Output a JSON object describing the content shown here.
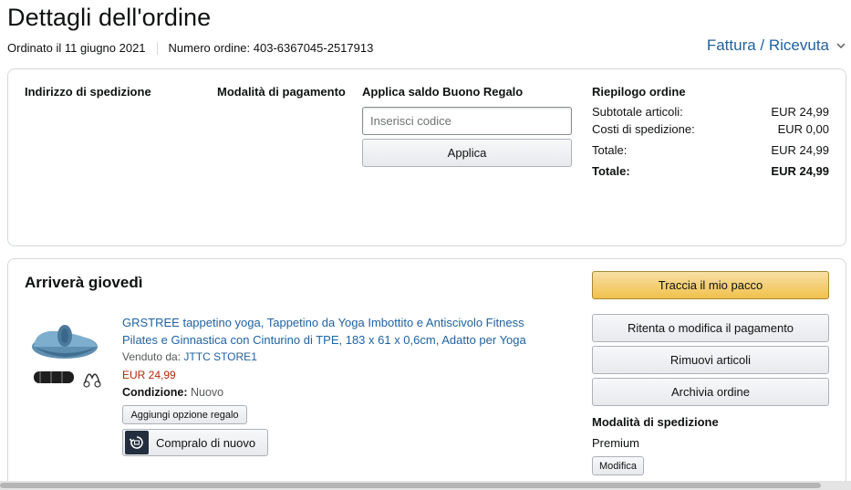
{
  "header": {
    "title": "Dettagli dell'ordine",
    "ordered_on": "Ordinato il 11 giugno 2021",
    "order_number": "Numero ordine: 403-6367045-2517913",
    "invoice_link": "Fattura / Ricevuta"
  },
  "details": {
    "shipping_address_title": "Indirizzo di spedizione",
    "payment_method_title": "Modalità di pagamento",
    "gift_card_title": "Applica saldo Buono Regalo",
    "code_placeholder": "Inserisci codice",
    "apply_label": "Applica",
    "summary_title": "Riepilogo ordine",
    "summary_rows": [
      {
        "label": "Subtotale articoli:",
        "value": "EUR 24,99"
      },
      {
        "label": "Costi di spedizione:",
        "value": "EUR 0,00"
      },
      {
        "label": "Totale:",
        "value": "EUR 24,99"
      },
      {
        "label": "Totale:",
        "value": "EUR 24,99"
      }
    ]
  },
  "shipment": {
    "arrival": "Arriverà giovedì",
    "product_title": "GRSTREE tappetino yoga, Tappetino da Yoga Imbottito e Antiscivolo Fitness Pilates e Ginnastica con Cinturino di TPE, 183 x 61 x 0,6cm, Adatto per Yoga",
    "sold_by_label": "Venduto da:",
    "seller_name": "JTTC STORE1",
    "price": "EUR 24,99",
    "condition_label": "Condizione:",
    "condition_value": "Nuovo",
    "gift_option_label": "Aggiungi opzione regalo",
    "buy_again_label": "Compralo di nuovo",
    "track_label": "Traccia il mio pacco",
    "retry_payment_label": "Ritenta o modifica il pagamento",
    "remove_items_label": "Rimuovi articoli",
    "archive_label": "Archivia ordine",
    "shipping_method_title": "Modalità di spedizione",
    "shipping_method_value": "Premium",
    "modify_label": "Modifica"
  },
  "colors": {
    "link": "#2162a1",
    "price": "#b12704",
    "primary_button": "#f0c14b"
  },
  "icons": {
    "invoice_chevron": "chevron-down-icon",
    "buy_again": "reorder-icon",
    "product": "yoga-mat-image"
  }
}
